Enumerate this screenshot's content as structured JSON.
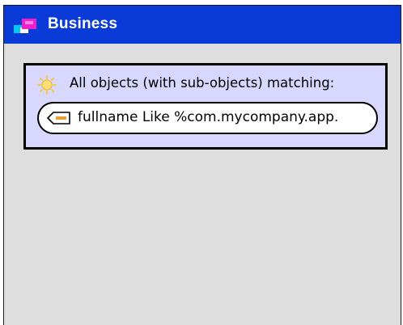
{
  "window": {
    "title": "Business",
    "title_icon": "business-object-icon",
    "titlebar_color": "#0a3bd8",
    "content_background": "#dedede"
  },
  "query": {
    "label": "All objects (with sub-objects) matching:",
    "icon": "sun-icon",
    "background": "#d8d8ff",
    "condition": {
      "text": "fullname Like %com.mycompany.app.",
      "icon": "tag-icon"
    }
  }
}
